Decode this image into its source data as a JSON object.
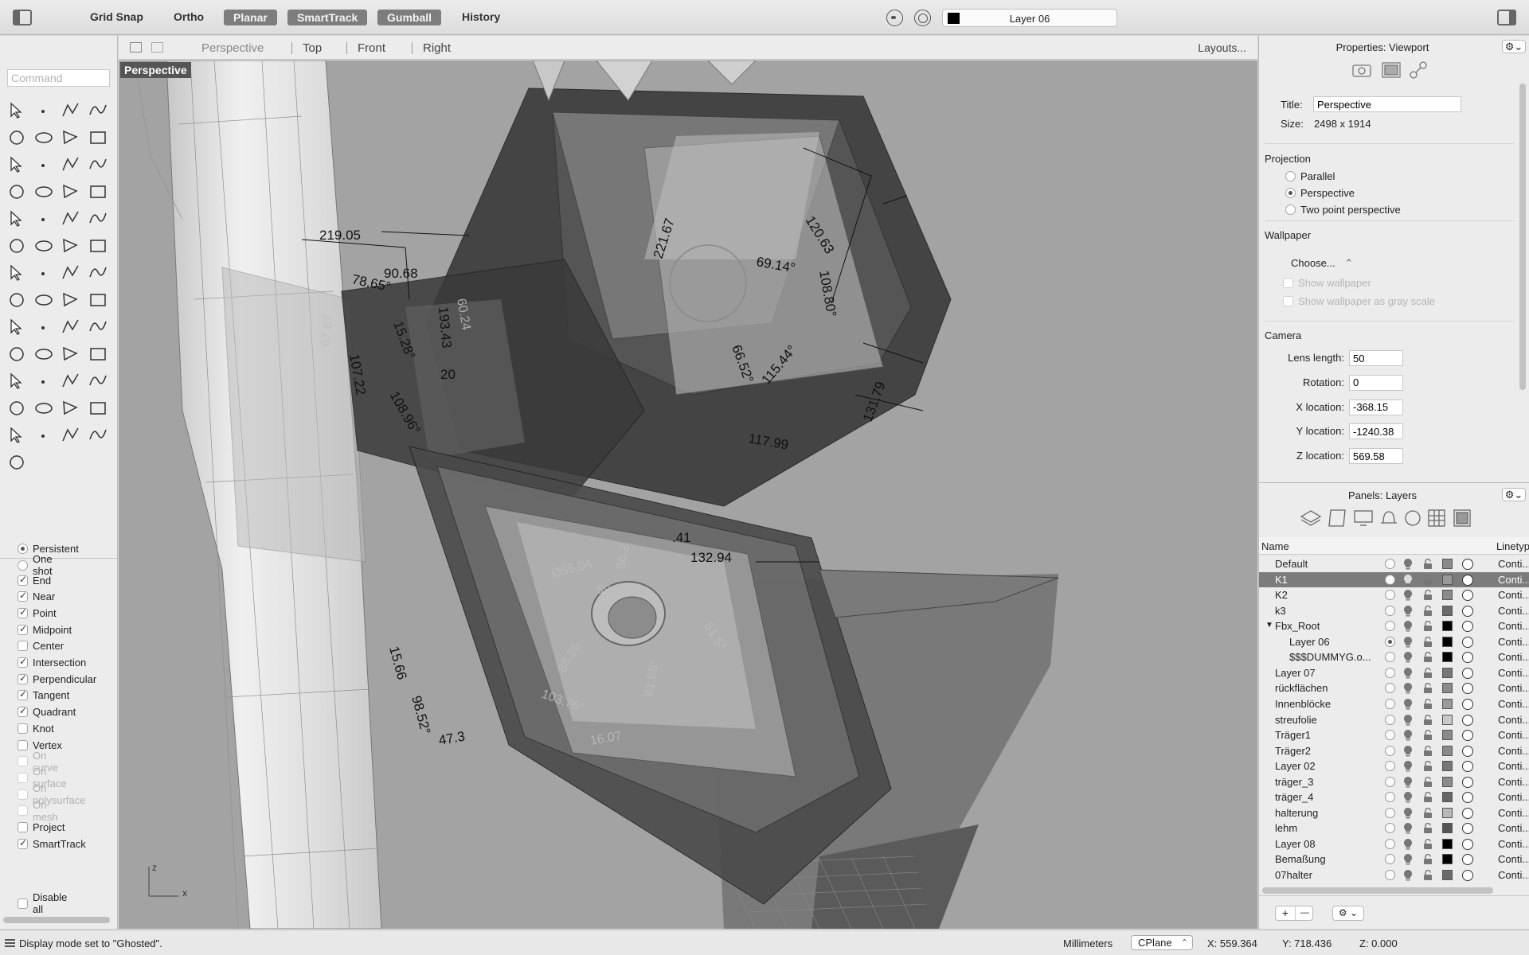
{
  "toolbar": {
    "items": [
      {
        "label": "Grid Snap",
        "active": false
      },
      {
        "label": "Ortho",
        "active": false
      },
      {
        "label": "Planar",
        "active": true
      },
      {
        "label": "SmartTrack",
        "active": true
      },
      {
        "label": "Gumball",
        "active": true
      },
      {
        "label": "History",
        "active": false
      }
    ],
    "current_layer": "Layer 06",
    "current_layer_color": "#000000"
  },
  "command": {
    "placeholder": "Command"
  },
  "viewport_tabs": {
    "tabs": [
      "Perspective",
      "Top",
      "Front",
      "Right"
    ],
    "active": "Perspective",
    "layouts": "Layouts..."
  },
  "viewport": {
    "label": "Perspective",
    "axis_z": "z",
    "axis_x": "x",
    "dimensions": [
      "219.05",
      "78.65°",
      "90.68",
      "15.28°",
      "193.43",
      "20",
      "67.67",
      "107.22",
      "108.96°",
      "221.67",
      "69.14°",
      "120.63",
      "108.80°",
      "66.52°",
      "115.44°",
      "117.99",
      "131.79",
      "132.94",
      ".41",
      "Ø55.04",
      "96.2",
      "59",
      "86.26",
      "81.65°",
      "103.76°",
      "15.66",
      "98.52°",
      "47.3",
      "51.5°",
      "60.24",
      "16.07"
    ]
  },
  "osnap": {
    "mode": [
      {
        "label": "Persistent",
        "selected": true
      },
      {
        "label": "One shot",
        "selected": false
      }
    ],
    "items": [
      {
        "label": "End",
        "checked": true,
        "enabled": true
      },
      {
        "label": "Near",
        "checked": true,
        "enabled": true
      },
      {
        "label": "Point",
        "checked": true,
        "enabled": true
      },
      {
        "label": "Midpoint",
        "checked": true,
        "enabled": true
      },
      {
        "label": "Center",
        "checked": false,
        "enabled": true
      },
      {
        "label": "Intersection",
        "checked": true,
        "enabled": true
      },
      {
        "label": "Perpendicular",
        "checked": true,
        "enabled": true
      },
      {
        "label": "Tangent",
        "checked": true,
        "enabled": true
      },
      {
        "label": "Quadrant",
        "checked": true,
        "enabled": true
      },
      {
        "label": "Knot",
        "checked": false,
        "enabled": true
      },
      {
        "label": "Vertex",
        "checked": false,
        "enabled": true
      },
      {
        "label": "On curve",
        "checked": false,
        "enabled": false
      },
      {
        "label": "On surface",
        "checked": false,
        "enabled": false
      },
      {
        "label": "On polysurface",
        "checked": false,
        "enabled": false
      },
      {
        "label": "On mesh",
        "checked": false,
        "enabled": false
      },
      {
        "label": "Project",
        "checked": false,
        "enabled": true
      },
      {
        "label": "SmartTrack",
        "checked": true,
        "enabled": true
      }
    ],
    "disable_all": "Disable all"
  },
  "properties": {
    "title": "Properties: Viewport",
    "title_label": "Title:",
    "title_value": "Perspective",
    "size_label": "Size:",
    "size_value": "2498 x 1914",
    "projection_title": "Projection",
    "projection_options": [
      {
        "label": "Parallel",
        "selected": false
      },
      {
        "label": "Perspective",
        "selected": true
      },
      {
        "label": "Two point perspective",
        "selected": false
      }
    ],
    "wallpaper_title": "Wallpaper",
    "wallpaper_choose": "Choose...",
    "show_wallpaper": "Show wallpaper",
    "show_gray": "Show wallpaper as gray scale",
    "camera_title": "Camera",
    "camera_fields": [
      {
        "label": "Lens length:",
        "value": "50"
      },
      {
        "label": "Rotation:",
        "value": "0"
      },
      {
        "label": "X location:",
        "value": "-368.15"
      },
      {
        "label": "Y location:",
        "value": "-1240.38"
      },
      {
        "label": "Z location:",
        "value": "569.58"
      }
    ]
  },
  "layers": {
    "title": "Panels: Layers",
    "col_name": "Name",
    "col_linetype": "Linetyp",
    "rows": [
      {
        "name": "Default",
        "indent": 0,
        "color": "#8a8a8a",
        "linetype": "Conti...",
        "selected": false,
        "current": false
      },
      {
        "name": "K1",
        "indent": 0,
        "color": "#9a9a9a",
        "linetype": "Conti...",
        "selected": true,
        "current": false
      },
      {
        "name": "K2",
        "indent": 0,
        "color": "#8a8a8a",
        "linetype": "Conti...",
        "selected": false,
        "current": false
      },
      {
        "name": "k3",
        "indent": 0,
        "color": "#6a6a6a",
        "linetype": "Conti...",
        "selected": false,
        "current": false
      },
      {
        "name": "Fbx_Root",
        "indent": 0,
        "color": "#000000",
        "linetype": "Conti...",
        "selected": false,
        "current": false,
        "expander": "▼"
      },
      {
        "name": "Layer 06",
        "indent": 2,
        "color": "#000000",
        "linetype": "Conti...",
        "selected": false,
        "current": true
      },
      {
        "name": "$$$DUMMYG.o...",
        "indent": 2,
        "color": "#000000",
        "linetype": "Conti...",
        "selected": false,
        "current": false
      },
      {
        "name": "Layer 07",
        "indent": 0,
        "color": "#777777",
        "linetype": "Conti...",
        "selected": false,
        "current": false
      },
      {
        "name": "rückflächen",
        "indent": 0,
        "color": "#8a8a8a",
        "linetype": "Conti...",
        "selected": false,
        "current": false
      },
      {
        "name": "Innenblöcke",
        "indent": 0,
        "color": "#9a9a9a",
        "linetype": "Conti...",
        "selected": false,
        "current": false
      },
      {
        "name": "streufolie",
        "indent": 0,
        "color": "#c8c8c8",
        "linetype": "Conti...",
        "selected": false,
        "current": false
      },
      {
        "name": "Träger1",
        "indent": 0,
        "color": "#8a8a8a",
        "linetype": "Conti...",
        "selected": false,
        "current": false
      },
      {
        "name": "Träger2",
        "indent": 0,
        "color": "#8a8a8a",
        "linetype": "Conti...",
        "selected": false,
        "current": false
      },
      {
        "name": "Layer 02",
        "indent": 0,
        "color": "#777777",
        "linetype": "Conti...",
        "selected": false,
        "current": false
      },
      {
        "name": "träger_3",
        "indent": 0,
        "color": "#8a8a8a",
        "linetype": "Conti...",
        "selected": false,
        "current": false
      },
      {
        "name": "träger_4",
        "indent": 0,
        "color": "#666666",
        "linetype": "Conti...",
        "selected": false,
        "current": false
      },
      {
        "name": "halterung",
        "indent": 0,
        "color": "#b8b8b8",
        "linetype": "Conti...",
        "selected": false,
        "current": false
      },
      {
        "name": "lehm",
        "indent": 0,
        "color": "#555555",
        "linetype": "Conti...",
        "selected": false,
        "current": false
      },
      {
        "name": "Layer 08",
        "indent": 0,
        "color": "#000000",
        "linetype": "Conti...",
        "selected": false,
        "current": false
      },
      {
        "name": "Bemaßung",
        "indent": 0,
        "color": "#000000",
        "linetype": "Conti...",
        "selected": false,
        "current": false
      },
      {
        "name": "07halter",
        "indent": 0,
        "color": "#6a6a6a",
        "linetype": "Conti...",
        "selected": false,
        "current": false
      }
    ],
    "add_btn": "+",
    "remove_btn": "—"
  },
  "status": {
    "message": "Display mode set to \"Ghosted\".",
    "units": "Millimeters",
    "cplane": "CPlane",
    "x": "X: 559.364",
    "y": "Y: 718.436",
    "z": "Z: 0.000"
  }
}
